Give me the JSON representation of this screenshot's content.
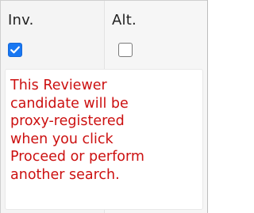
{
  "columns": {
    "inv": {
      "label": "Inv.",
      "checked": true
    },
    "alt": {
      "label": "Alt.",
      "checked": false
    }
  },
  "notice": {
    "text": "This Reviewer\ncandidate will be\nproxy-registered\nwhen you click\nProceed or perform\nanother search.",
    "color": "#cc1010"
  },
  "colors": {
    "checkbox_checked": "#1877f2"
  },
  "icons": {
    "checkmark": "checkmark-icon"
  }
}
